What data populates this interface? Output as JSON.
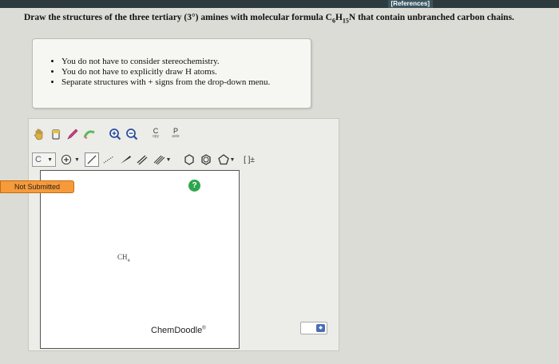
{
  "header": {
    "references": "[References]"
  },
  "question": {
    "prefix": "Draw the structures of the three tertiary (3°) amines with molecular formula C",
    "sub1": "6",
    "mid": "H",
    "sub2": "15",
    "suffix": "N that contain unbranched carbon chains."
  },
  "hints": [
    "You do not have to consider stereochemistry.",
    "You do not have to explicitly draw H atoms.",
    "Separate structures with + signs from the drop-down menu."
  ],
  "toolbar": {
    "copy_label": "C",
    "copy_small": "opy",
    "paste_label": "P",
    "paste_small": "aste",
    "element_value": "C",
    "bracket_label": "[ ]±"
  },
  "canvas": {
    "molecule_main": "CH",
    "molecule_sub": "4",
    "brand": "ChemDoodle",
    "brand_mark": "®"
  },
  "status": {
    "not_submitted": "Not Submitted"
  },
  "help": {
    "label": "?"
  },
  "icons": [
    "hand-icon",
    "eraser-icon",
    "pencil-icon",
    "bond-pencil-icon",
    "zoom-in-icon",
    "zoom-out-icon",
    "charge-plus-icon",
    "single-bond-icon",
    "dashed-bond-icon",
    "wedge-bond-icon",
    "double-bond-icon",
    "triple-bond-icon",
    "hexagon-icon",
    "benzene-icon",
    "pentagon-icon",
    "dropdown-arrow-icon"
  ],
  "colors": {
    "not_submitted_bg": "#f79a3a",
    "help_bg": "#2da64e",
    "topbar": "#2e3b3e"
  }
}
